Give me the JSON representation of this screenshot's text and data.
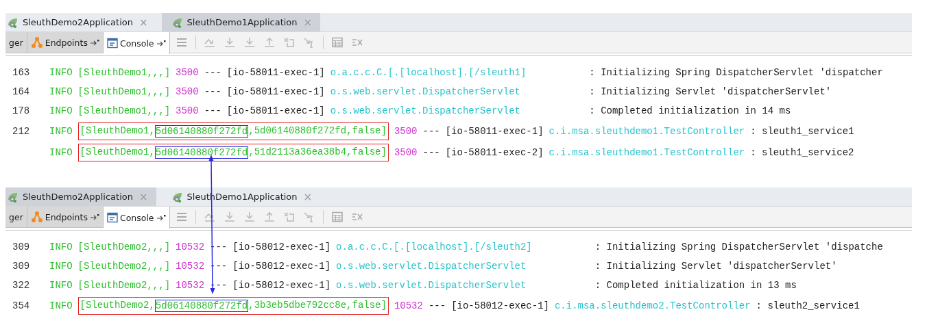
{
  "panels": [
    {
      "tabs": [
        {
          "label": "SleuthDemo2Application",
          "close": "×",
          "selected": false
        },
        {
          "label": "SleuthDemo1Application",
          "close": "×",
          "selected": true
        }
      ],
      "tool_tabs": [
        {
          "kind": "plain",
          "label": "ger",
          "selected": false
        },
        {
          "kind": "endpoints",
          "label": "Endpoints",
          "selected": false
        },
        {
          "kind": "console",
          "label": "Console",
          "selected": true
        }
      ],
      "lines": [
        {
          "kind": "plain",
          "number": "163",
          "level": "INFO",
          "trace": "[SleuthDemo1,,,]",
          "pid": "3500",
          "sep": "---",
          "thread": "[io-58011-exec-1]",
          "logger": "o.a.c.c.C.[.[localhost].[/sleuth1]",
          "message": ": Initializing Spring DispatcherServlet 'dispatcher"
        },
        {
          "kind": "plain",
          "number": "164",
          "level": "INFO",
          "trace": "[SleuthDemo1,,,]",
          "pid": "3500",
          "sep": "---",
          "thread": "[io-58011-exec-1]",
          "logger": "o.s.web.servlet.DispatcherServlet",
          "message": ": Initializing Servlet 'dispatcherServlet'"
        },
        {
          "kind": "plain",
          "number": "178",
          "level": "INFO",
          "trace": "[SleuthDemo1,,,]",
          "pid": "3500",
          "sep": "---",
          "thread": "[io-58011-exec-1]",
          "logger": "o.s.web.servlet.DispatcherServlet",
          "message": ": Completed initialization in 14 ms"
        },
        {
          "kind": "traced",
          "number": "212",
          "level": "INFO",
          "trace_parts": [
            "[SleuthDemo1,",
            "5d06140880f272fd",
            ",5d06140880f272fd,false]"
          ],
          "pid": "3500",
          "sep": "---",
          "thread": "[io-58011-exec-1]",
          "logger": "c.i.msa.sleuthdemo1.TestController",
          "message": ": sleuth1_service1"
        },
        {
          "kind": "traced",
          "level": "INFO",
          "trace_parts": [
            "[SleuthDemo1,",
            "5d06140880f272fd",
            ",51d2113a36ea38b4,false]"
          ],
          "pid": "3500",
          "sep": "---",
          "thread": "[io-58011-exec-2]",
          "logger": "c.i.msa.sleuthdemo1.TestController",
          "message": ": sleuth1_service2"
        }
      ]
    },
    {
      "tabs": [
        {
          "label": "SleuthDemo2Application",
          "close": "×",
          "selected": true
        },
        {
          "label": "SleuthDemo1Application",
          "close": "×",
          "selected": false
        }
      ],
      "tool_tabs": [
        {
          "kind": "plain",
          "label": "ger",
          "selected": false
        },
        {
          "kind": "endpoints",
          "label": "Endpoints",
          "selected": false
        },
        {
          "kind": "console",
          "label": "Console",
          "selected": true
        }
      ],
      "lines": [
        {
          "kind": "plain",
          "number": "309",
          "level": "INFO",
          "trace": "[SleuthDemo2,,,]",
          "pid": "10532",
          "sep": "---",
          "thread": "[io-58012-exec-1]",
          "logger": "o.a.c.c.C.[.[localhost].[/sleuth2]",
          "message": ": Initializing Spring DispatcherServlet 'dispatche"
        },
        {
          "kind": "plain",
          "number": "309",
          "level": "INFO",
          "trace": "[SleuthDemo2,,,]",
          "pid": "10532",
          "sep": "---",
          "thread": "[io-58012-exec-1]",
          "logger": "o.s.web.servlet.DispatcherServlet",
          "message": ": Initializing Servlet 'dispatcherServlet'"
        },
        {
          "kind": "plain",
          "number": "322",
          "level": "INFO",
          "trace": "[SleuthDemo2,,,]",
          "pid": "10532",
          "sep": "---",
          "thread": "[io-58012-exec-1]",
          "logger": "o.s.web.servlet.DispatcherServlet",
          "message": ": Completed initialization in 13 ms"
        },
        {
          "kind": "traced",
          "number": "354",
          "level": "INFO",
          "trace_parts": [
            "[SleuthDemo2,",
            "5d06140880f272fd",
            ",3b3eb5dbe792cc8e,false]"
          ],
          "pid": "10532",
          "sep": "---",
          "thread": "[io-58012-exec-1]",
          "logger": "c.i.msa.sleuthdemo2.TestController",
          "message": ": sleuth2_service1"
        }
      ]
    }
  ]
}
